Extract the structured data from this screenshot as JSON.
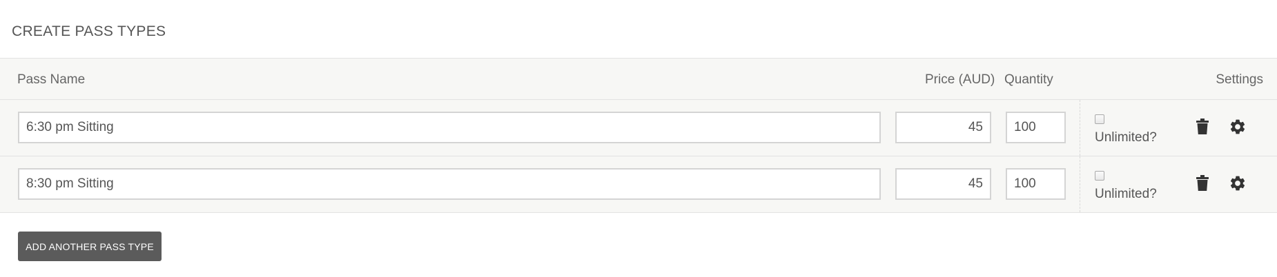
{
  "section": {
    "title": "CREATE PASS TYPES"
  },
  "table": {
    "headers": {
      "name": "Pass Name",
      "price": "Price (AUD)",
      "quantity": "Quantity",
      "settings": "Settings"
    },
    "rows": [
      {
        "name": "6:30 pm Sitting",
        "price": "45",
        "quantity": "100",
        "unlimited_label": "Unlimited?",
        "unlimited_checked": false
      },
      {
        "name": "8:30 pm Sitting",
        "price": "45",
        "quantity": "100",
        "unlimited_label": "Unlimited?",
        "unlimited_checked": false
      }
    ]
  },
  "actions": {
    "add_label": "ADD ANOTHER PASS TYPE"
  },
  "colors": {
    "button_bg": "#5b5b5b",
    "row_bg": "#f7f7f5",
    "icon": "#333333"
  },
  "icons": {
    "delete": "trash-icon",
    "settings": "gear-icon"
  }
}
